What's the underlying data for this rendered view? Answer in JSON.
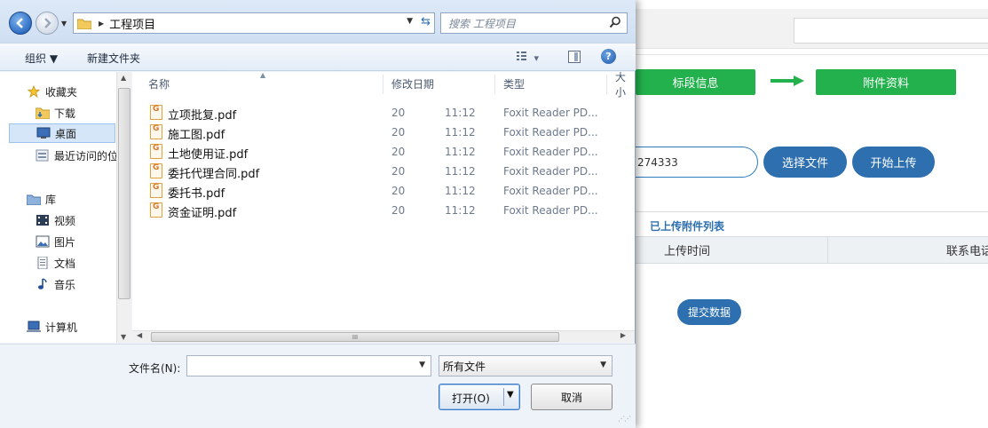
{
  "background": {
    "steps": [
      "标段信息",
      "附件资料"
    ],
    "file_input_value": "274333",
    "choose_file_label": "选择文件",
    "start_upload_label": "开始上传",
    "uploaded_list_title": "已上传附件列表",
    "table_headers": [
      "上传时间",
      "联系电话"
    ],
    "submit_label": "提交数据",
    "accent_green": "#23b14d",
    "accent_blue": "#2d6faf"
  },
  "dialog": {
    "address": {
      "path_label": "工程项目",
      "search_placeholder": "搜索 工程项目"
    },
    "toolbar": {
      "organize_label": "组织 ▼",
      "new_folder_label": "新建文件夹",
      "view_label": "▾",
      "help_label": "?"
    },
    "nav": [
      {
        "label": "收藏夹",
        "icon": "star-icon"
      },
      {
        "label": "下载",
        "icon": "download-folder-icon"
      },
      {
        "label": "桌面",
        "icon": "desktop-icon",
        "selected": true
      },
      {
        "label": "最近访问的位置",
        "icon": "recent-places-icon"
      },
      {
        "label": "库",
        "icon": "library-icon"
      },
      {
        "label": "视频",
        "icon": "video-icon"
      },
      {
        "label": "图片",
        "icon": "pictures-icon"
      },
      {
        "label": "文档",
        "icon": "documents-icon"
      },
      {
        "label": "音乐",
        "icon": "music-icon"
      },
      {
        "label": "计算机",
        "icon": "computer-icon"
      }
    ],
    "columns": [
      "名称",
      "修改日期",
      "类型",
      "大小"
    ],
    "files": [
      {
        "name": "立项批复.pdf",
        "date": "20",
        "time": "11:12",
        "type": "Foxit Reader PD..."
      },
      {
        "name": "施工图.pdf",
        "date": "20",
        "time": "11:12",
        "type": "Foxit Reader PD..."
      },
      {
        "name": "土地使用证.pdf",
        "date": "20",
        "time": "11:12",
        "type": "Foxit Reader PD..."
      },
      {
        "name": "委托代理合同.pdf",
        "date": "20",
        "time": "11:12",
        "type": "Foxit Reader PD..."
      },
      {
        "name": "委托书.pdf",
        "date": "20",
        "time": "11:12",
        "type": "Foxit Reader PD..."
      },
      {
        "name": "资金证明.pdf",
        "date": "20",
        "time": "11:12",
        "type": "Foxit Reader PD..."
      }
    ],
    "hscroll_label": "III",
    "filename_label": "文件名(N):",
    "filename_value": "",
    "filetype_value": "所有文件",
    "open_label": "打开(O)",
    "cancel_label": "取消"
  }
}
